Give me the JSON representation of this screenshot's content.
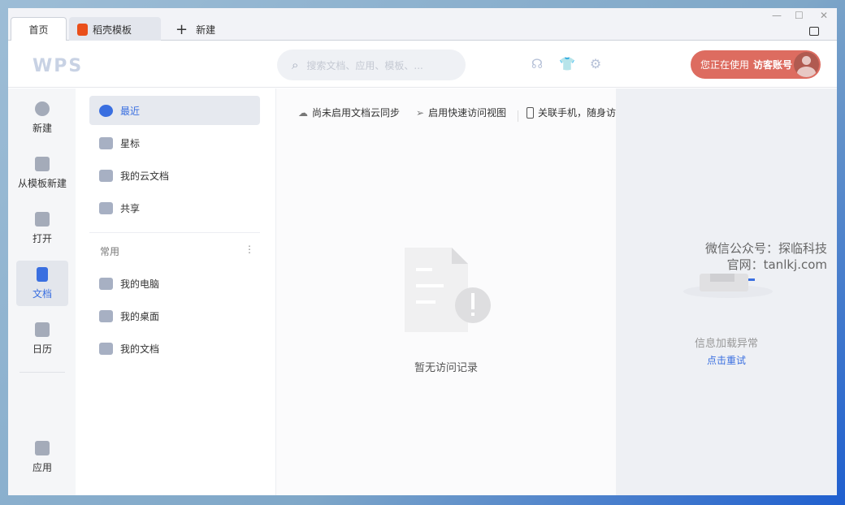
{
  "tabs": {
    "home": "首页",
    "template": "稻壳模板",
    "new": "新建"
  },
  "window_controls": {
    "minimize": "—",
    "maximize": "☐",
    "close": "✕"
  },
  "header": {
    "logo": "WPS",
    "search_placeholder": "搜索文档、应用、模板、...",
    "account_prefix": "您正在使用",
    "account_name": "访客账号"
  },
  "rail": [
    {
      "label": "新建"
    },
    {
      "label": "从模板新建"
    },
    {
      "label": "打开"
    },
    {
      "label": "文档"
    },
    {
      "label": "日历"
    },
    {
      "label": "应用"
    }
  ],
  "nav": {
    "items": [
      "最近",
      "星标",
      "我的云文档",
      "共享"
    ],
    "section": "常用",
    "more": "⋮",
    "common": [
      "我的电脑",
      "我的桌面",
      "我的文档"
    ]
  },
  "main": {
    "quick": [
      "尚未启用文档云同步",
      "启用快速访问视图",
      "关联手机，随身访"
    ],
    "empty": "暂无访问记录"
  },
  "right": {
    "error": "信息加载异常",
    "retry": "点击重试"
  },
  "watermark": {
    "line1": "微信公众号：探临科技",
    "line2": "官网：tanlkj.com"
  }
}
